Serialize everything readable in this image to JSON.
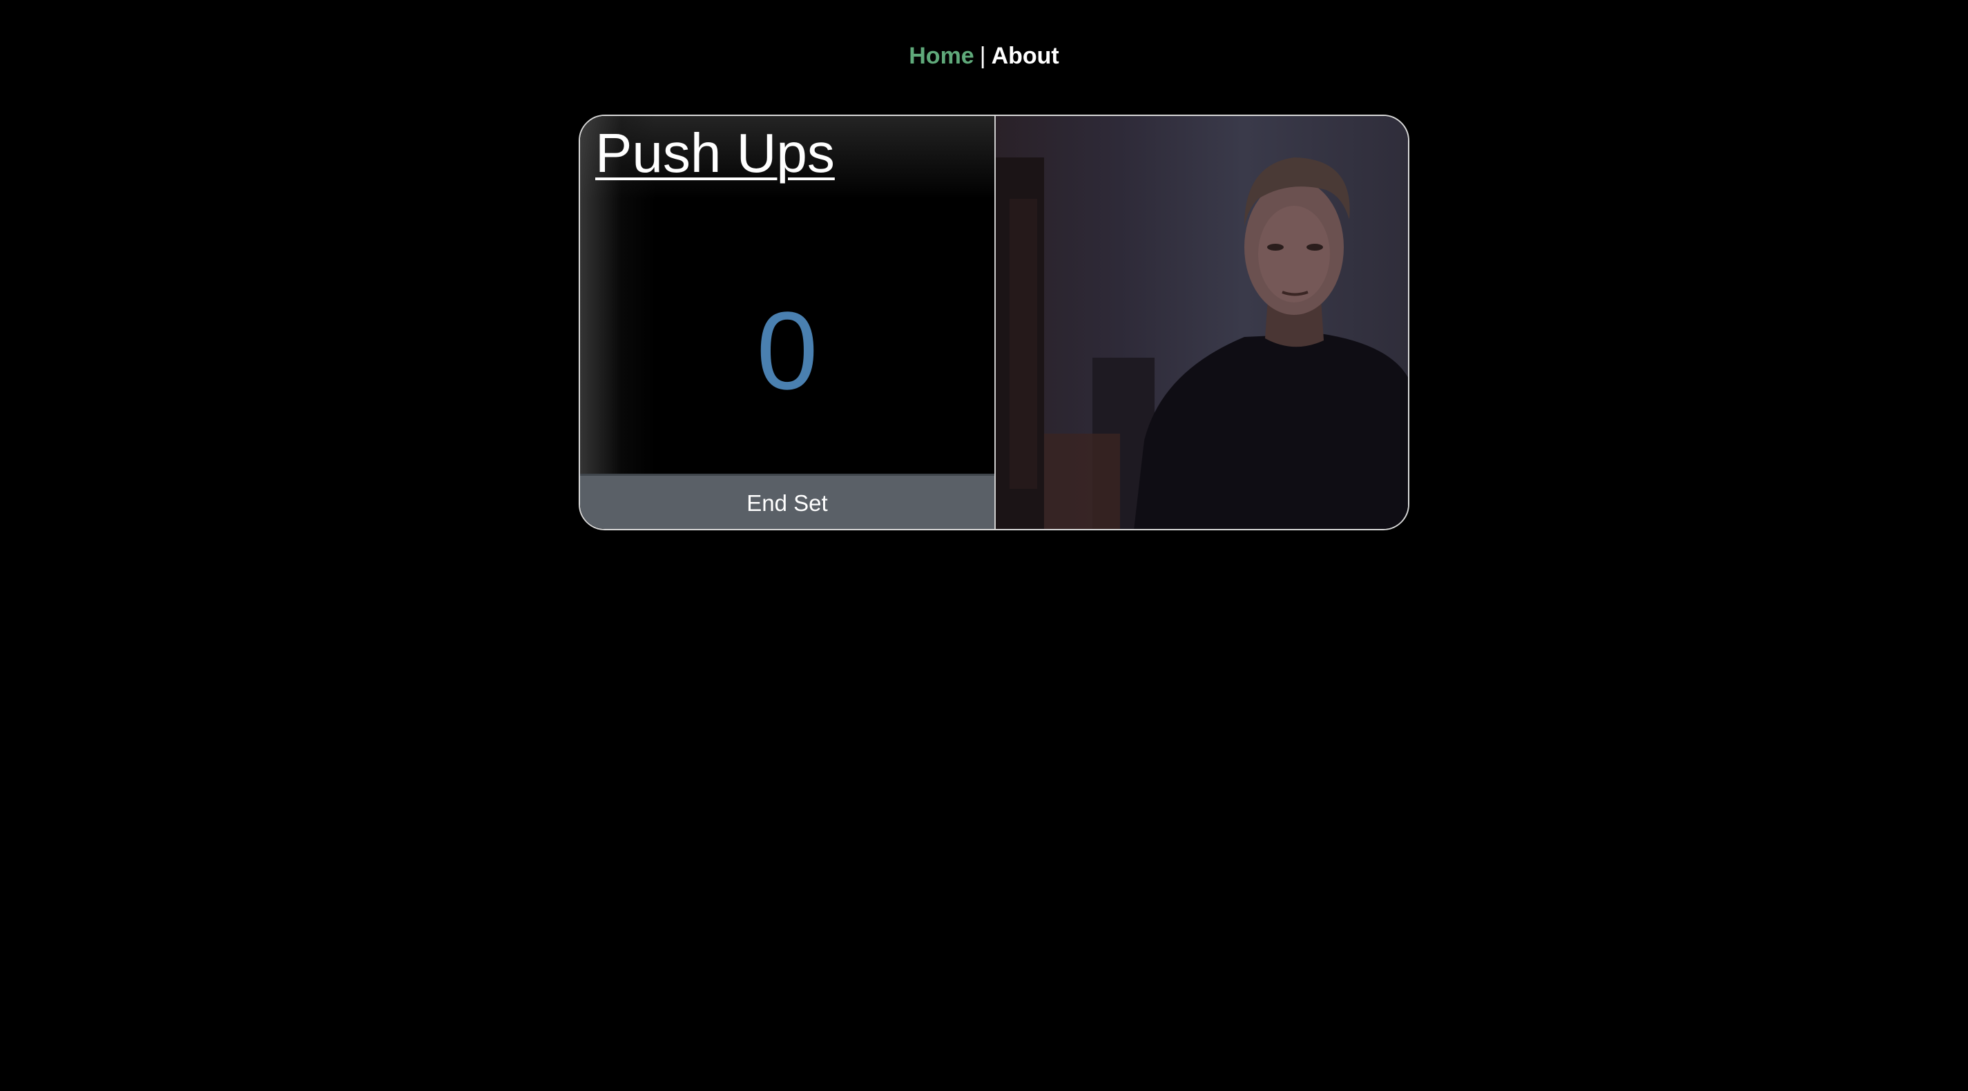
{
  "nav": {
    "home_label": "Home",
    "separator": "|",
    "about_label": "About",
    "home_color": "#5fa97a",
    "about_color": "#ffffff"
  },
  "exercise": {
    "title": "Push Ups",
    "count": "0",
    "count_color": "#4a80b0",
    "end_button_label": "End Set"
  },
  "video": {
    "icon": "webcam-feed"
  }
}
